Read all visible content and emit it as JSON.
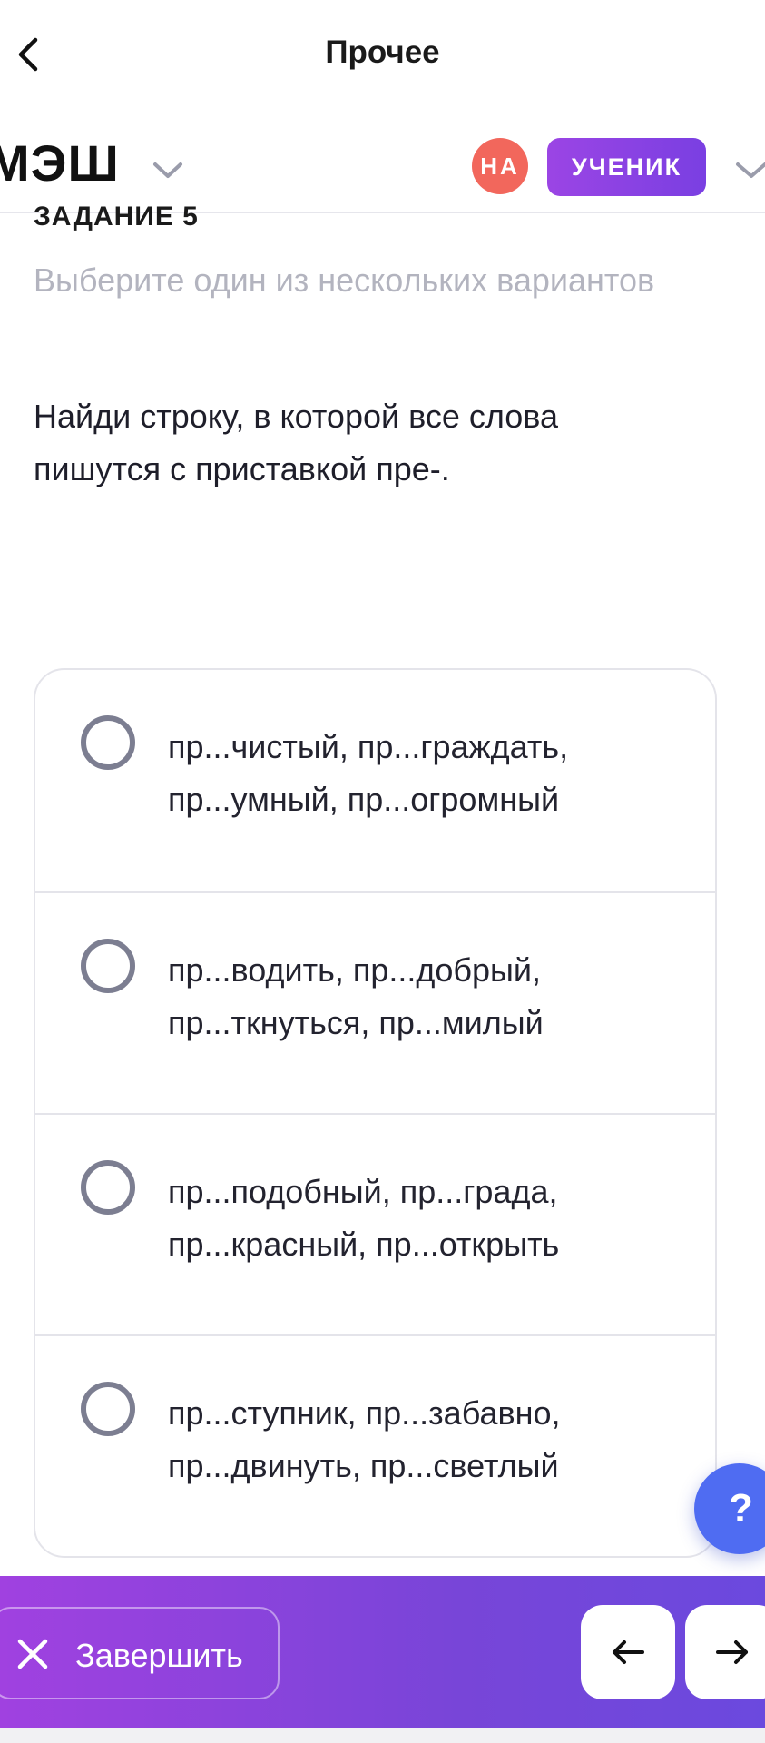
{
  "topbar": {
    "title": "Прочее"
  },
  "header": {
    "brand": "МЭШ",
    "avatar_initials": "НА",
    "role": "УЧЕНИК"
  },
  "task": {
    "label": "ЗАДАНИЕ 5",
    "instruction": "Выберите один из нескольких вариантов",
    "question": "Найди строку, в которой все слова пишутся с приставкой пре-."
  },
  "options": [
    {
      "line1": "пр...чистый, пр...граждать,",
      "line2": "пр...умный, пр...огромный",
      "selected": false
    },
    {
      "line1": "пр...водить, пр...добрый,",
      "line2": "пр...ткнуться, пр...милый",
      "selected": false
    },
    {
      "line1": "пр...подобный, пр...града,",
      "line2": "пр...красный, пр...открыть",
      "selected": false
    },
    {
      "line1": "пр...ступник, пр...забавно,",
      "line2": "пр...двинуть, пр...светлый",
      "selected": false
    }
  ],
  "help": {
    "label": "?"
  },
  "bottombar": {
    "finish_label": "Завершить"
  },
  "icons": {
    "back": "chevron-left-icon",
    "brand_dropdown": "chevron-down-icon",
    "user_dropdown": "chevron-down-icon",
    "finish": "close-icon",
    "prev": "arrow-left-icon",
    "next": "arrow-right-icon"
  },
  "colors": {
    "accent_purple": "#8a42e0",
    "avatar": "#f2675c",
    "help_blue": "#4f6cf2",
    "muted_text": "#b3b4bf"
  }
}
